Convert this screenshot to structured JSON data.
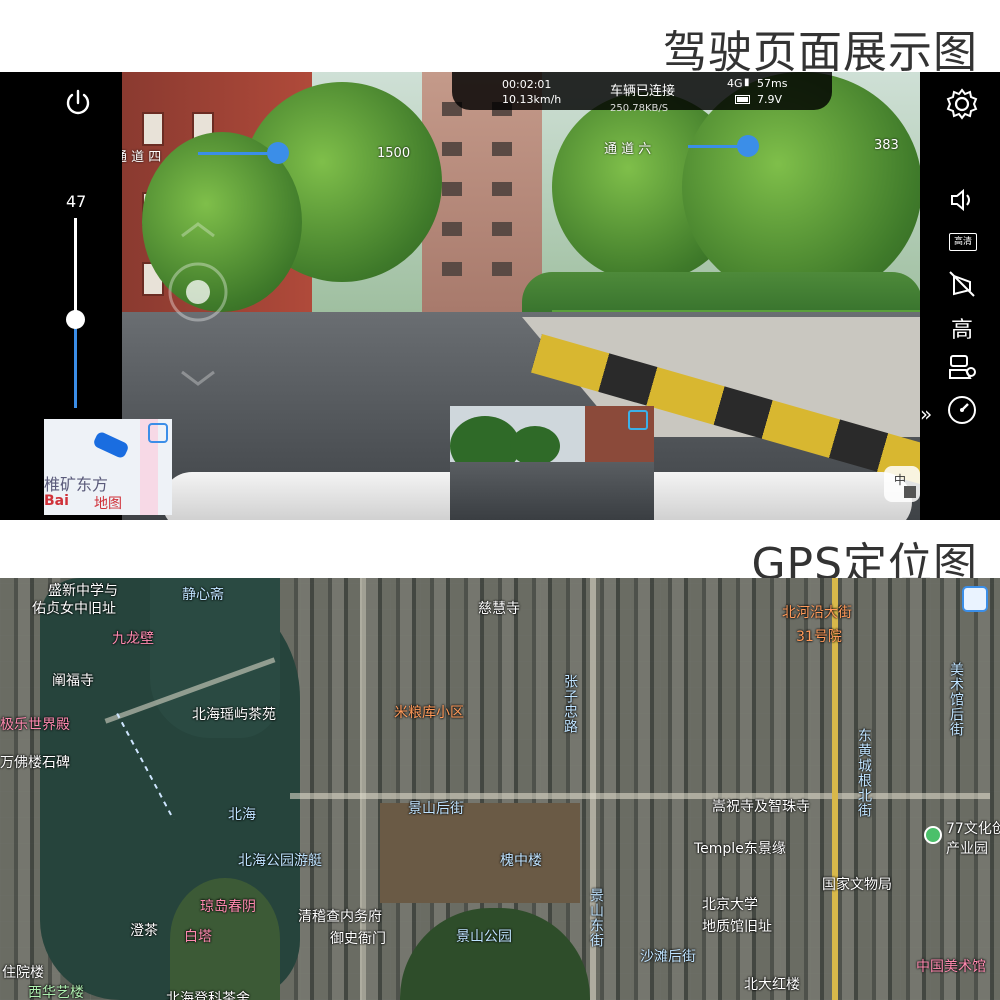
{
  "titles": {
    "driving": "驾驶页面展示图",
    "gps": "GPS定位图"
  },
  "status": {
    "time": "00:02:01",
    "speed": "10.13km/h",
    "connection": "车辆已连接",
    "rate": "250.78KB/S",
    "network": "4G",
    "ping": "57ms",
    "voltage": "7.9V"
  },
  "overlay": {
    "channel4_label": "通 道 四",
    "channel4_value": "1500",
    "channel6_label": "通 道 六",
    "channel6_value": "383",
    "channel4_level": 0.5,
    "channel6_level": 0.5
  },
  "left_slider": {
    "value": "47",
    "level": 0.47
  },
  "right_bar": {
    "hd_label": "高清",
    "quality_label": "高"
  },
  "mini_map": {
    "place": "椎矿东方",
    "brand": "Bai",
    "brand2": "地图"
  },
  "icons": {
    "power": "power-icon",
    "settings": "gear-icon",
    "volume": "speaker-icon",
    "light_off": "light-off-icon",
    "vehicle_location": "vehicle-location-icon",
    "speedometer": "speedometer-icon",
    "mic": "microphone-icon",
    "expand": "chevron-right-double-icon"
  },
  "map_labels": [
    {
      "id": "shengxin",
      "text": "盛新中学与",
      "cls": ""
    },
    {
      "id": "youzhen",
      "text": "佑贞女中旧址",
      "cls": ""
    },
    {
      "id": "jingxin",
      "text": "静心斋",
      "cls": "blue"
    },
    {
      "id": "jiulongbi",
      "text": "九龙壁",
      "cls": "pink"
    },
    {
      "id": "chanfu",
      "text": "阐福寺",
      "cls": ""
    },
    {
      "id": "jile",
      "text": "极乐世界殿",
      "cls": "pink"
    },
    {
      "id": "wanfo",
      "text": "万佛楼石碑",
      "cls": ""
    },
    {
      "id": "yaoyu",
      "text": "北海瑶屿茶苑",
      "cls": ""
    },
    {
      "id": "beihai",
      "text": "北海",
      "cls": "blue"
    },
    {
      "id": "bhpark",
      "text": "北海公园游艇",
      "cls": "blue"
    },
    {
      "id": "qiongdao",
      "text": "琼岛春阴",
      "cls": "pink"
    },
    {
      "id": "chengcha",
      "text": "澄茶",
      "cls": ""
    },
    {
      "id": "baita",
      "text": "白塔",
      "cls": "pink"
    },
    {
      "id": "qingji",
      "text": "清稽查内务府",
      "cls": ""
    },
    {
      "id": "yushi",
      "text": "御史衙门",
      "cls": ""
    },
    {
      "id": "cishou",
      "text": "慈慧寺",
      "cls": ""
    },
    {
      "id": "miliang",
      "text": "米粮库小区",
      "cls": "orange"
    },
    {
      "id": "jshouj",
      "text": "景山后街",
      "cls": "blue"
    },
    {
      "id": "guozhong",
      "text": "槐中楼",
      "cls": "blue"
    },
    {
      "id": "jspark",
      "text": "景山公园",
      "cls": "blue"
    },
    {
      "id": "beiheyan",
      "text": "北河沿大街",
      "cls": "orange"
    },
    {
      "id": "yard31",
      "text": "31号院",
      "cls": "orange"
    },
    {
      "id": "songzhu",
      "text": "嵩祝寺及智珠寺",
      "cls": ""
    },
    {
      "id": "temple",
      "text": "Temple东景缘",
      "cls": ""
    },
    {
      "id": "pku",
      "text": "北京大学",
      "cls": ""
    },
    {
      "id": "dizhi",
      "text": "地质馆旧址",
      "cls": ""
    },
    {
      "id": "guojia",
      "text": "国家文物局",
      "cls": ""
    },
    {
      "id": "shatan",
      "text": "沙滩后街",
      "cls": "blue"
    },
    {
      "id": "beidahong",
      "text": "北大红楼",
      "cls": ""
    },
    {
      "id": "culture77",
      "text": "77文化创意",
      "cls": ""
    },
    {
      "id": "chanye",
      "text": "产业园",
      "cls": ""
    },
    {
      "id": "zhongguo",
      "text": "中国美术馆",
      "cls": "pink"
    },
    {
      "id": "zhuyuan",
      "text": "住院楼",
      "cls": ""
    },
    {
      "id": "xihua",
      "text": "西华艺楼",
      "cls": "green"
    },
    {
      "id": "beihaideng",
      "text": "北海登科茶舍",
      "cls": ""
    },
    {
      "id": "dongcheng",
      "text": "东黄城根北街",
      "cls": "blue"
    },
    {
      "id": "jshdong",
      "text": "景山东街",
      "cls": "blue"
    },
    {
      "id": "zhangzi",
      "text": "张子忠路",
      "cls": "blue"
    },
    {
      "id": "meishu",
      "text": "美术馆后街",
      "cls": "blue"
    }
  ]
}
